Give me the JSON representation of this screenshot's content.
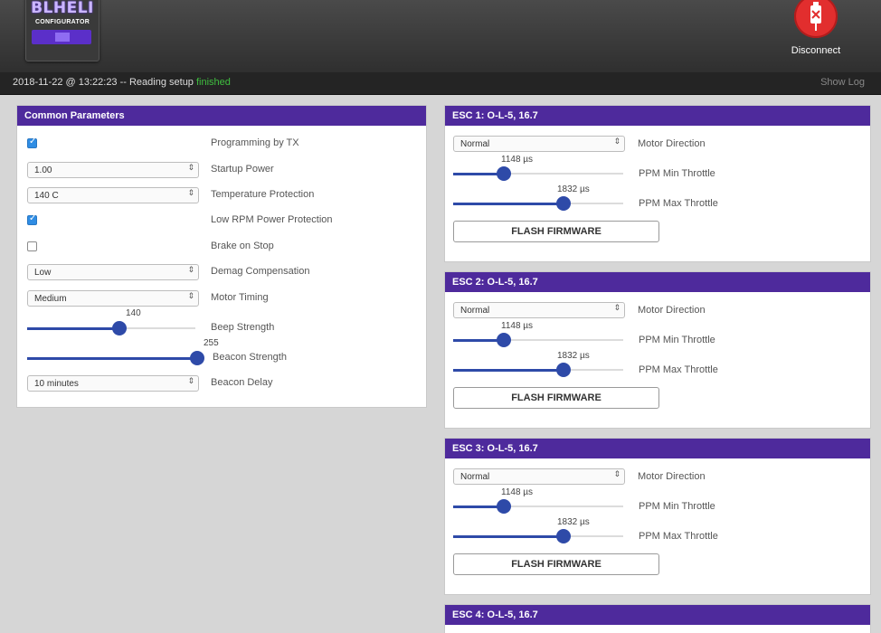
{
  "header": {
    "logo_title": "BLHELI",
    "logo_subtitle": "CONFIGURATOR",
    "disconnect_label": "Disconnect"
  },
  "status": {
    "text": "2018-11-22 @ 13:22:23 -- Reading setup",
    "state": "finished",
    "show_log": "Show Log"
  },
  "common": {
    "title": "Common Parameters",
    "programming_by_tx": {
      "label": "Programming by TX",
      "checked": true
    },
    "startup_power": {
      "label": "Startup Power",
      "value": "1.00"
    },
    "temperature_protection": {
      "label": "Temperature Protection",
      "value": "140 C"
    },
    "low_rpm_power_protection": {
      "label": "Low RPM Power Protection",
      "checked": true
    },
    "brake_on_stop": {
      "label": "Brake on Stop",
      "checked": false
    },
    "demag_compensation": {
      "label": "Demag Compensation",
      "value": "Low"
    },
    "motor_timing": {
      "label": "Motor Timing",
      "value": "Medium"
    },
    "beep_strength": {
      "label": "Beep Strength",
      "value": "140",
      "fraction": 0.55
    },
    "beacon_strength": {
      "label": "Beacon Strength",
      "value": "255",
      "fraction": 1.0
    },
    "beacon_delay": {
      "label": "Beacon Delay",
      "value": "10 minutes"
    }
  },
  "escs": [
    {
      "title": "ESC 1: O-L-5, 16.7",
      "motor_direction": "Normal",
      "motor_direction_label": "Motor Direction",
      "min_throttle": "1148 µs",
      "min_throttle_label": "PPM Min Throttle",
      "min_fraction": 0.3,
      "max_throttle": "1832 µs",
      "max_throttle_label": "PPM Max Throttle",
      "max_fraction": 0.65,
      "flash_label": "FLASH FIRMWARE"
    },
    {
      "title": "ESC 2: O-L-5, 16.7",
      "motor_direction": "Normal",
      "motor_direction_label": "Motor Direction",
      "min_throttle": "1148 µs",
      "min_throttle_label": "PPM Min Throttle",
      "min_fraction": 0.3,
      "max_throttle": "1832 µs",
      "max_throttle_label": "PPM Max Throttle",
      "max_fraction": 0.65,
      "flash_label": "FLASH FIRMWARE"
    },
    {
      "title": "ESC 3: O-L-5, 16.7",
      "motor_direction": "Normal",
      "motor_direction_label": "Motor Direction",
      "min_throttle": "1148 µs",
      "min_throttle_label": "PPM Min Throttle",
      "min_fraction": 0.3,
      "max_throttle": "1832 µs",
      "max_throttle_label": "PPM Max Throttle",
      "max_fraction": 0.65,
      "flash_label": "FLASH FIRMWARE"
    },
    {
      "title": "ESC 4: O-L-5, 16.7"
    }
  ],
  "icons": {
    "select_arrow": "select-arrow-icon",
    "check": "check-icon",
    "usb_disconnect": "usb-disconnect-icon"
  },
  "colors": {
    "panel_header": "#4e2a9c",
    "slider": "#2e4aa8",
    "disconnect": "#e22e2e",
    "status_ok": "#3fbf3f"
  }
}
